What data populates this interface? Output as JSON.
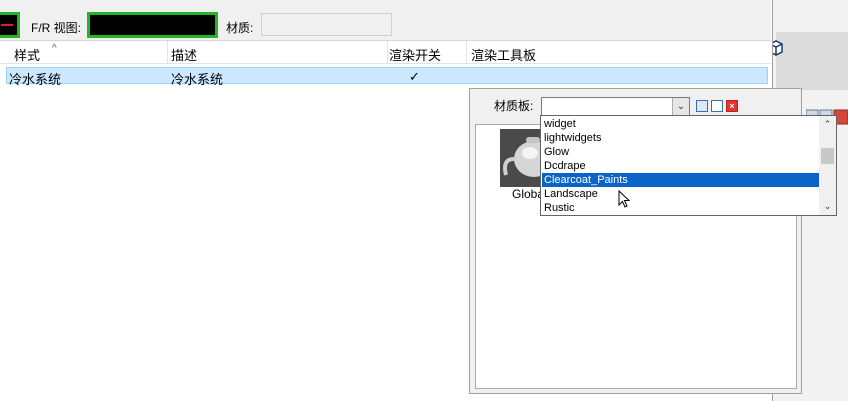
{
  "toolbar": {
    "fr_view_label": "F/R 视图:",
    "material_label": "材质:"
  },
  "table": {
    "columns": [
      "样式",
      "描述",
      "渲染开关",
      "渲染工具板"
    ],
    "sort_indicator": "^",
    "rows": [
      {
        "style": "冷水系统",
        "description": "冷水系统",
        "render_toggle": "✓",
        "render_palette": ""
      }
    ]
  },
  "material_panel": {
    "label": "材质板:",
    "combo_value": "",
    "thumbnail_label": "Global"
  },
  "dropdown": {
    "items": [
      "widget",
      "lightwidgets",
      "Glow",
      "Dcdrape",
      "Clearcoat_Paints",
      "Landscape",
      "Rustic"
    ],
    "selected": "Clearcoat_Paints"
  },
  "colors": {
    "selection_blue": "#0a64c8",
    "row_highlight": "#cce8ff",
    "viewport_border_green": "#25b425"
  }
}
